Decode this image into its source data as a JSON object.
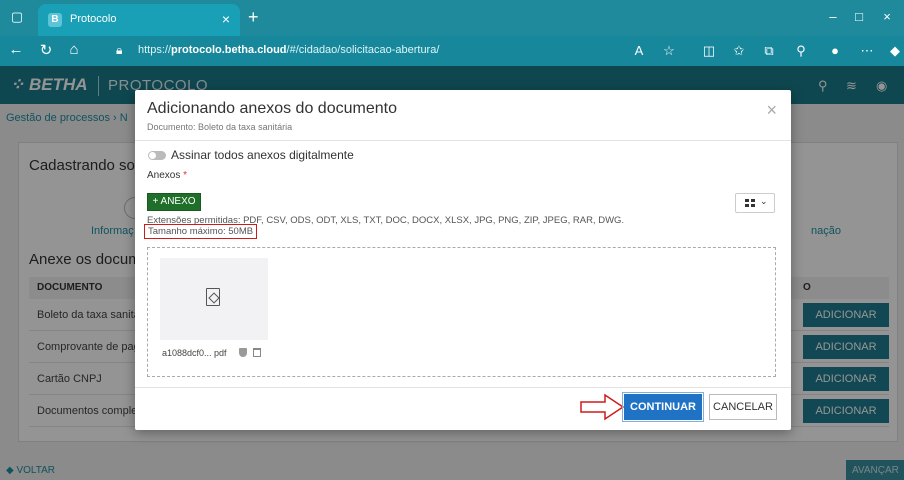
{
  "browser": {
    "tab_icon": "B",
    "tab_title": "Protocolo",
    "tab_close": "×",
    "new_tab": "+",
    "url_prefix": "https://",
    "url_domain": "protocolo.betha.cloud",
    "url_path": "/#/cidadao/solicitacao-abertura/",
    "win_min": "–",
    "win_max": "□",
    "win_close": "×"
  },
  "app": {
    "logo": "BETHA",
    "product": "PROTOCOLO"
  },
  "page": {
    "breadcrumb": "Gestão de processos  ›  N",
    "title": "Cadastrando solic",
    "step_left": "Informaç",
    "step_right": "nação",
    "section_title": "Anexe os docum",
    "col_document": "DOCUMENTO",
    "col_action": "O",
    "documents": [
      {
        "name": "Boleto da taxa sanitári",
        "action": "ADICIONAR"
      },
      {
        "name": "Comprovante de paga",
        "action": "ADICIONAR"
      },
      {
        "name": "Cartão CNPJ",
        "action": "ADICIONAR"
      },
      {
        "name": "Documentos complem",
        "action": "ADICIONAR"
      }
    ],
    "back": "◆ VOLTAR",
    "next": "AVANÇAR →"
  },
  "modal": {
    "title": "Adicionando anexos do documento",
    "subtitle": "Documento: Boleto da taxa sanitária",
    "close": "×",
    "sign_all_label": "Assinar todos anexos digitalmente",
    "anexos_label": "Anexos",
    "required_mark": "*",
    "add_anexo_btn": "+ ANEXO",
    "view_toggle_chevron": "⌄",
    "extensions": "Extensões permitidas: PDF, CSV, ODS, ODT, XLS, TXT, DOC, DOCX, XLSX, JPG, PNG, ZIP, JPEG, RAR, DWG.",
    "max_size": "Tamanho máximo: 50MB",
    "file": {
      "name": "a1088dcf0... pdf"
    },
    "continue_btn": "CONTINUAR",
    "cancel_btn": "CANCELAR"
  },
  "colors": {
    "teal_header": "#1b7a8a",
    "continue_blue": "#1f72c4",
    "anexo_green": "#1f6e2a",
    "highlight_red": "#d01a1a"
  }
}
